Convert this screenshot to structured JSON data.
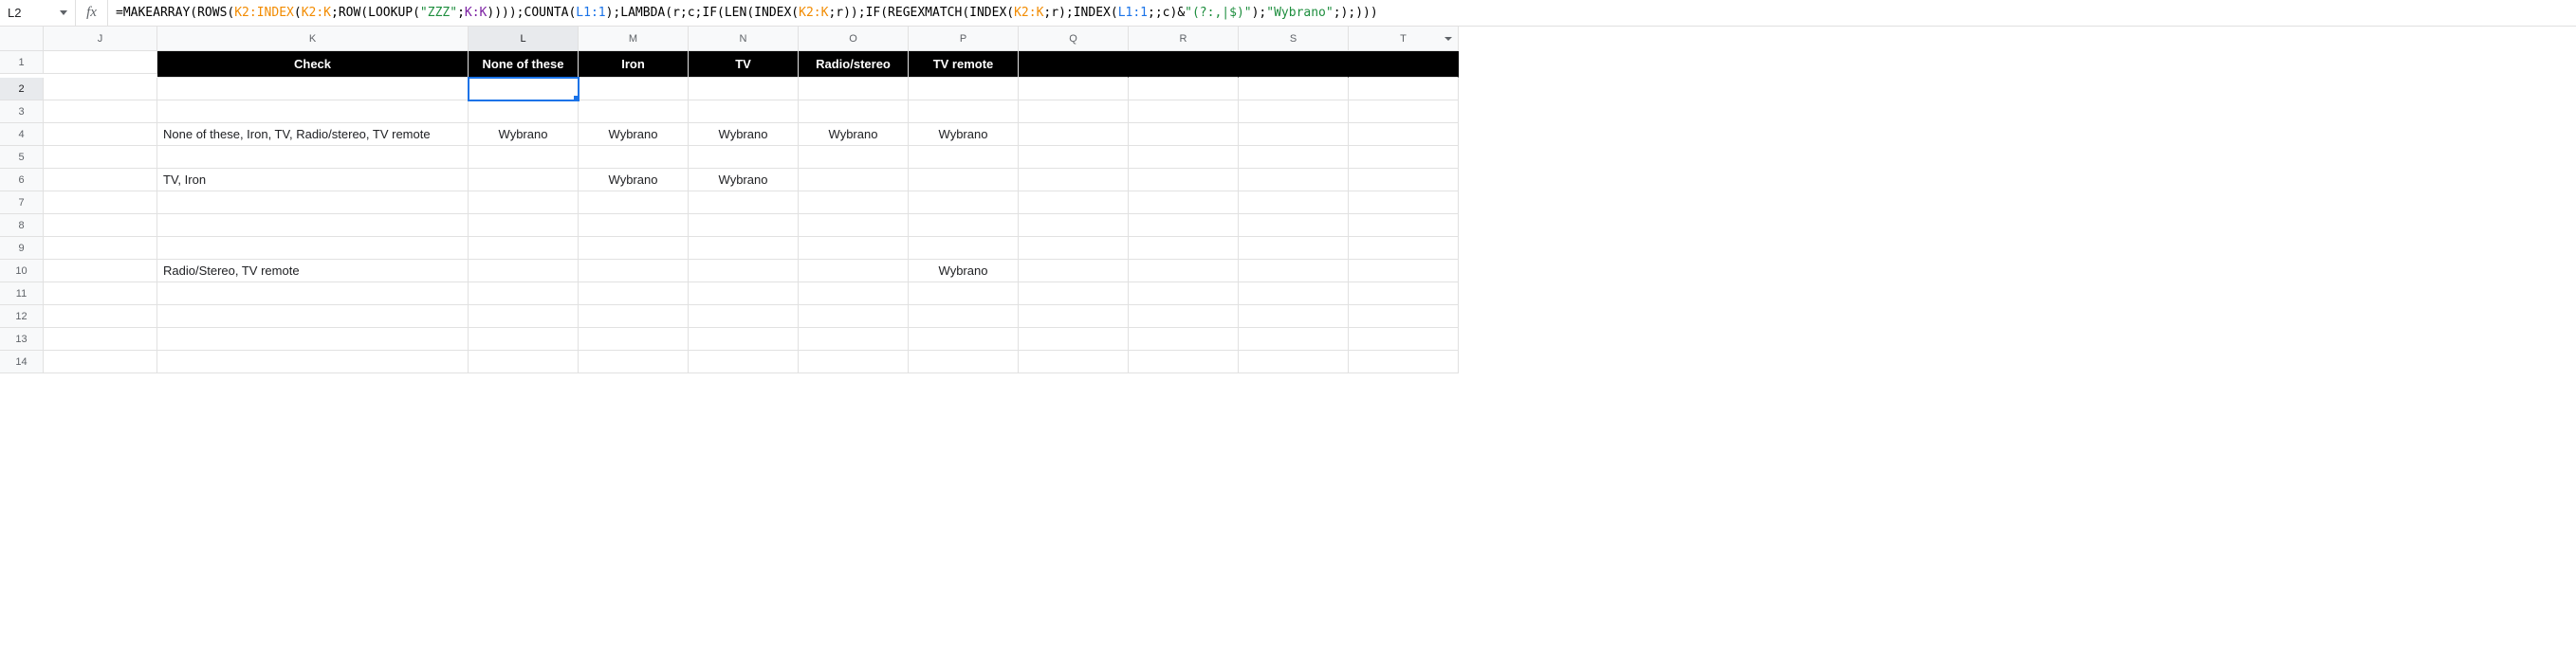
{
  "name_box": "L2",
  "formula": {
    "parts": [
      {
        "t": "=MAKEARRAY(ROWS(",
        "c": "fn"
      },
      {
        "t": "K2:INDEX",
        "c": "r1"
      },
      {
        "t": "(",
        "c": "fn"
      },
      {
        "t": "K2:K",
        "c": "r1"
      },
      {
        "t": ";ROW(LOOKUP(",
        "c": "fn"
      },
      {
        "t": "\"ZZZ\"",
        "c": "str"
      },
      {
        "t": ";",
        "c": "fn"
      },
      {
        "t": "K:K",
        "c": "r2"
      },
      {
        "t": "))));COUNTA(",
        "c": "fn"
      },
      {
        "t": "L1:1",
        "c": "r3"
      },
      {
        "t": ");LAMBDA(",
        "c": "fn"
      },
      {
        "t": "r",
        "c": "var"
      },
      {
        "t": ";",
        "c": "fn"
      },
      {
        "t": "c",
        "c": "var"
      },
      {
        "t": ";IF(LEN(INDEX(",
        "c": "fn"
      },
      {
        "t": "K2:K",
        "c": "r1"
      },
      {
        "t": ";",
        "c": "fn"
      },
      {
        "t": "r",
        "c": "var"
      },
      {
        "t": "));IF(REGEXMATCH(INDEX(",
        "c": "fn"
      },
      {
        "t": "K2:K",
        "c": "r1"
      },
      {
        "t": ";",
        "c": "fn"
      },
      {
        "t": "r",
        "c": "var"
      },
      {
        "t": ");INDEX(",
        "c": "fn"
      },
      {
        "t": "L1:1",
        "c": "r3"
      },
      {
        "t": ";;",
        "c": "fn"
      },
      {
        "t": "c",
        "c": "var"
      },
      {
        "t": ")&",
        "c": "fn"
      },
      {
        "t": "\"(?:,|$)\"",
        "c": "str"
      },
      {
        "t": ");",
        "c": "fn"
      },
      {
        "t": "\"Wybrano\"",
        "c": "str"
      },
      {
        "t": ";);)))",
        "c": "fn"
      }
    ]
  },
  "columns": [
    "J",
    "K",
    "L",
    "M",
    "N",
    "O",
    "P",
    "Q",
    "R",
    "S",
    "T"
  ],
  "active_col_index": 2,
  "active_row": 2,
  "header_row": {
    "K": "Check",
    "L": "None of these",
    "M": "Iron",
    "N": "TV",
    "O": "Radio/stereo",
    "P": "TV remote"
  },
  "rows": [
    {
      "n": 1
    },
    {
      "n": 2
    },
    {
      "n": 3
    },
    {
      "n": 4,
      "K": "None of these, Iron, TV, Radio/stereo, TV remote",
      "L": "Wybrano",
      "M": "Wybrano",
      "N": "Wybrano",
      "O": "Wybrano",
      "P": "Wybrano"
    },
    {
      "n": 5
    },
    {
      "n": 6,
      "K": "TV, Iron",
      "M": "Wybrano",
      "N": "Wybrano"
    },
    {
      "n": 7
    },
    {
      "n": 8
    },
    {
      "n": 9
    },
    {
      "n": 10,
      "K": "Radio/Stereo, TV remote",
      "P": "Wybrano"
    },
    {
      "n": 11
    },
    {
      "n": 12
    },
    {
      "n": 13
    },
    {
      "n": 14
    }
  ],
  "chart_data": {
    "type": "table",
    "columns": [
      "Check",
      "None of these",
      "Iron",
      "TV",
      "Radio/stereo",
      "TV remote"
    ],
    "rows": [
      [
        "None of these, Iron, TV, Radio/stereo, TV remote",
        "Wybrano",
        "Wybrano",
        "Wybrano",
        "Wybrano",
        "Wybrano"
      ],
      [
        "TV, Iron",
        "",
        "Wybrano",
        "Wybrano",
        "",
        ""
      ],
      [
        "Radio/Stereo, TV remote",
        "",
        "",
        "",
        "",
        "Wybrano"
      ]
    ]
  }
}
